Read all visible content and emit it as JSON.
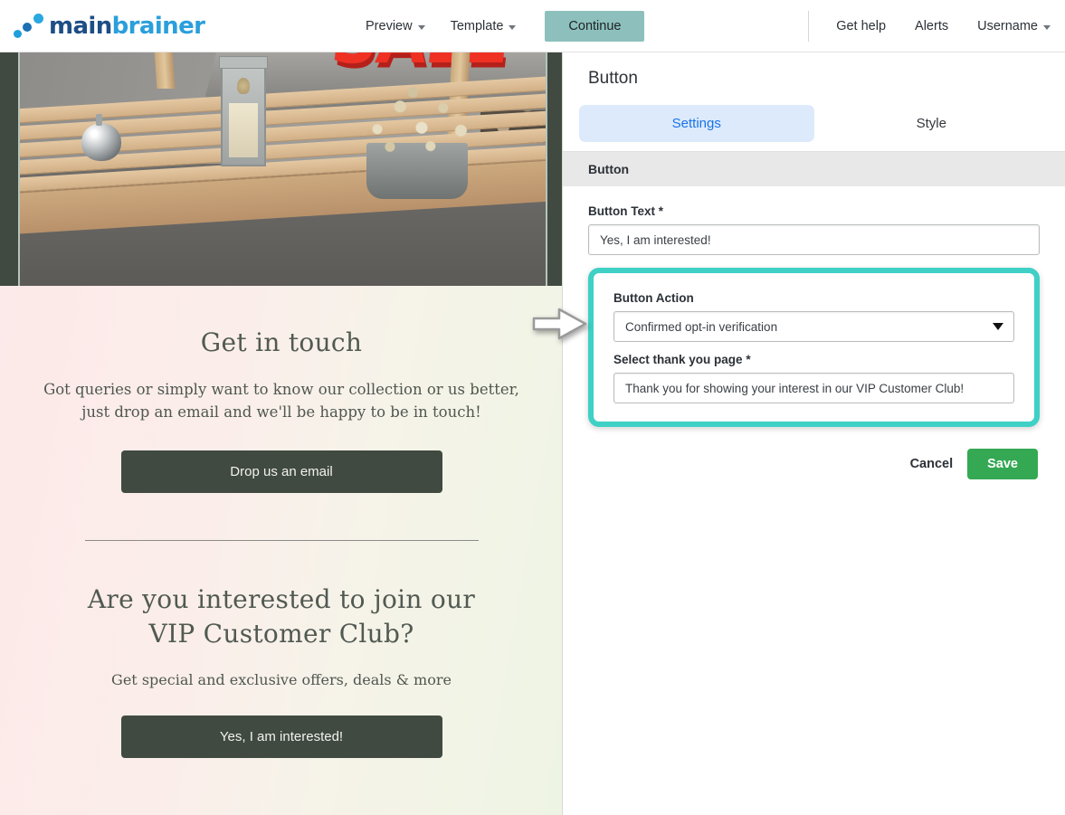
{
  "header": {
    "logo": {
      "main": "main",
      "brain": "brainer",
      "icon": "logo-dots-icon"
    },
    "nav": [
      {
        "label": "Preview",
        "has_caret": true
      },
      {
        "label": "Template",
        "has_caret": true
      }
    ],
    "continue_label": "Continue",
    "right_nav": [
      {
        "label": "Get help",
        "has_caret": false
      },
      {
        "label": "Alerts",
        "has_caret": false
      },
      {
        "label": "Username",
        "has_caret": true
      }
    ]
  },
  "preview": {
    "image": {
      "alt": "outdoor wooden bench with lantern, teapot and dried flowers",
      "sale_text": "SALE"
    },
    "section1": {
      "heading": "Get in touch",
      "paragraph_line1": "Got queries or simply want to know our collection or us better,",
      "paragraph_line2": "just drop an email and we'll be happy to be in touch!",
      "button_label": "Drop us an email"
    },
    "section2": {
      "heading_line1": "Are you interested to join our",
      "heading_line2": "VIP Customer Club?",
      "subtext": "Get special and exclusive offers, deals & more",
      "button_label": "Yes, I am interested!"
    }
  },
  "panel": {
    "title": "Button",
    "tabs": [
      {
        "label": "Settings",
        "active": true
      },
      {
        "label": "Style",
        "active": false
      }
    ],
    "section_header": "Button",
    "button_text": {
      "label": "Button Text",
      "required_mark": "*",
      "value": "Yes, I am interested!"
    },
    "button_action": {
      "label": "Button Action",
      "selected": "Confirmed opt-in verification",
      "caret_icon": "chevron-down-icon"
    },
    "thank_you_page": {
      "label": "Select thank you page",
      "required_mark": "*",
      "value": "Thank you for showing your interest in our VIP Customer Club!"
    },
    "cancel_label": "Cancel",
    "save_label": "Save"
  },
  "colors": {
    "highlight_teal": "#3fd0c6",
    "continue_teal": "#8dc0bc",
    "save_green": "#34a853",
    "tab_blue": "#1a73e8",
    "tab_blue_bg": "#dceafb",
    "template_dark": "#404a40"
  }
}
